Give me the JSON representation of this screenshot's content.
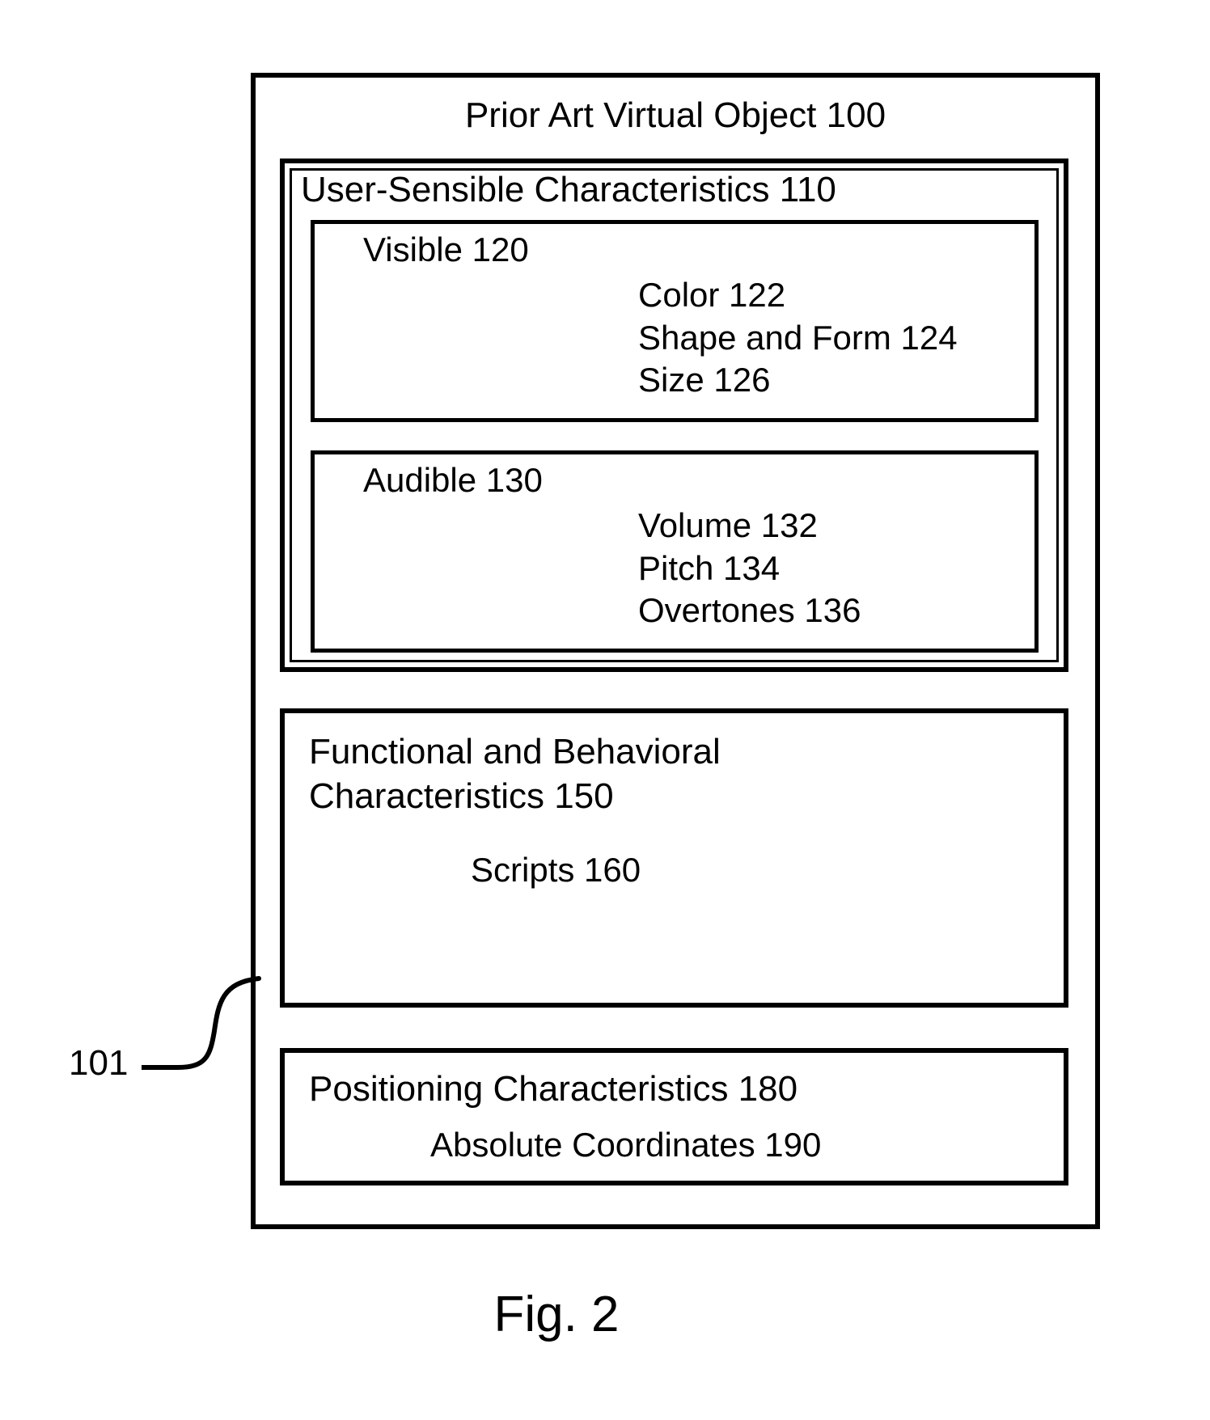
{
  "outer": {
    "title": "Prior Art Virtual Object 100"
  },
  "user_sensible": {
    "title": "User-Sensible Characteristics 110",
    "visible": {
      "title": "Visible 120",
      "items": [
        "Color 122",
        "Shape and Form 124",
        "Size 126"
      ]
    },
    "audible": {
      "title": "Audible 130",
      "items": [
        "Volume 132",
        "Pitch 134",
        "Overtones 136"
      ]
    }
  },
  "functional": {
    "title_line1": "Functional and Behavioral",
    "title_line2": "Characteristics 150",
    "scripts": "Scripts  160"
  },
  "positioning": {
    "title": "Positioning Characteristics 180",
    "coords": "Absolute Coordinates 190"
  },
  "lead": {
    "label": "101"
  },
  "figure_label": "Fig. 2"
}
